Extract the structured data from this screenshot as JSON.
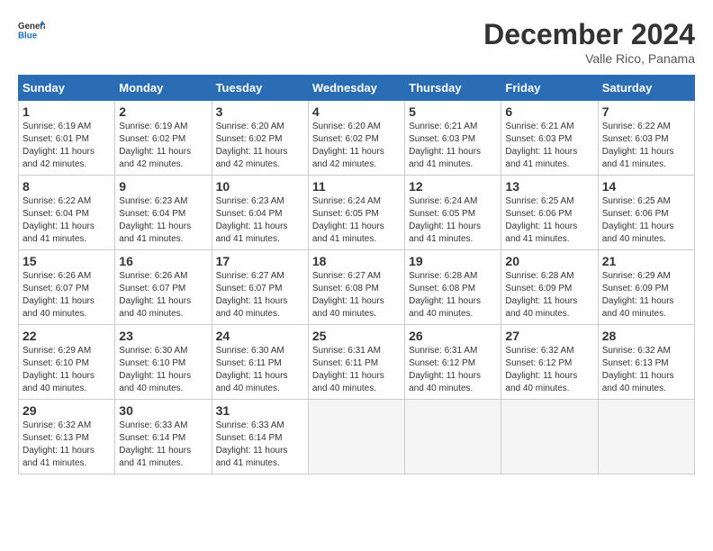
{
  "header": {
    "logo_general": "General",
    "logo_blue": "Blue",
    "month_title": "December 2024",
    "location": "Valle Rico, Panama"
  },
  "calendar": {
    "days_of_week": [
      "Sunday",
      "Monday",
      "Tuesday",
      "Wednesday",
      "Thursday",
      "Friday",
      "Saturday"
    ],
    "weeks": [
      [
        {
          "day": null,
          "info": null
        },
        {
          "day": null,
          "info": null
        },
        {
          "day": null,
          "info": null
        },
        {
          "day": null,
          "info": null
        },
        {
          "day": null,
          "info": null
        },
        {
          "day": null,
          "info": null
        },
        {
          "day": null,
          "info": null
        }
      ]
    ],
    "cells": [
      {
        "num": null,
        "sunrise": null,
        "sunset": null,
        "daylight": null
      },
      {
        "num": null,
        "sunrise": null,
        "sunset": null,
        "daylight": null
      },
      {
        "num": null,
        "sunrise": null,
        "sunset": null,
        "daylight": null
      },
      {
        "num": null,
        "sunrise": null,
        "sunset": null,
        "daylight": null
      },
      {
        "num": null,
        "sunrise": null,
        "sunset": null,
        "daylight": null
      },
      {
        "num": null,
        "sunrise": null,
        "sunset": null,
        "daylight": null
      },
      {
        "num": "1",
        "sunrise": "Sunrise: 6:19 AM",
        "sunset": "Sunset: 6:01 PM",
        "daylight": "Daylight: 11 hours and 42 minutes."
      },
      {
        "num": "2",
        "sunrise": "Sunrise: 6:19 AM",
        "sunset": "Sunset: 6:02 PM",
        "daylight": "Daylight: 11 hours and 42 minutes."
      },
      {
        "num": "3",
        "sunrise": "Sunrise: 6:20 AM",
        "sunset": "Sunset: 6:02 PM",
        "daylight": "Daylight: 11 hours and 42 minutes."
      },
      {
        "num": "4",
        "sunrise": "Sunrise: 6:20 AM",
        "sunset": "Sunset: 6:02 PM",
        "daylight": "Daylight: 11 hours and 42 minutes."
      },
      {
        "num": "5",
        "sunrise": "Sunrise: 6:21 AM",
        "sunset": "Sunset: 6:03 PM",
        "daylight": "Daylight: 11 hours and 41 minutes."
      },
      {
        "num": "6",
        "sunrise": "Sunrise: 6:21 AM",
        "sunset": "Sunset: 6:03 PM",
        "daylight": "Daylight: 11 hours and 41 minutes."
      },
      {
        "num": "7",
        "sunrise": "Sunrise: 6:22 AM",
        "sunset": "Sunset: 6:03 PM",
        "daylight": "Daylight: 11 hours and 41 minutes."
      },
      {
        "num": "8",
        "sunrise": "Sunrise: 6:22 AM",
        "sunset": "Sunset: 6:04 PM",
        "daylight": "Daylight: 11 hours and 41 minutes."
      },
      {
        "num": "9",
        "sunrise": "Sunrise: 6:23 AM",
        "sunset": "Sunset: 6:04 PM",
        "daylight": "Daylight: 11 hours and 41 minutes."
      },
      {
        "num": "10",
        "sunrise": "Sunrise: 6:23 AM",
        "sunset": "Sunset: 6:04 PM",
        "daylight": "Daylight: 11 hours and 41 minutes."
      },
      {
        "num": "11",
        "sunrise": "Sunrise: 6:24 AM",
        "sunset": "Sunset: 6:05 PM",
        "daylight": "Daylight: 11 hours and 41 minutes."
      },
      {
        "num": "12",
        "sunrise": "Sunrise: 6:24 AM",
        "sunset": "Sunset: 6:05 PM",
        "daylight": "Daylight: 11 hours and 41 minutes."
      },
      {
        "num": "13",
        "sunrise": "Sunrise: 6:25 AM",
        "sunset": "Sunset: 6:06 PM",
        "daylight": "Daylight: 11 hours and 41 minutes."
      },
      {
        "num": "14",
        "sunrise": "Sunrise: 6:25 AM",
        "sunset": "Sunset: 6:06 PM",
        "daylight": "Daylight: 11 hours and 40 minutes."
      },
      {
        "num": "15",
        "sunrise": "Sunrise: 6:26 AM",
        "sunset": "Sunset: 6:07 PM",
        "daylight": "Daylight: 11 hours and 40 minutes."
      },
      {
        "num": "16",
        "sunrise": "Sunrise: 6:26 AM",
        "sunset": "Sunset: 6:07 PM",
        "daylight": "Daylight: 11 hours and 40 minutes."
      },
      {
        "num": "17",
        "sunrise": "Sunrise: 6:27 AM",
        "sunset": "Sunset: 6:07 PM",
        "daylight": "Daylight: 11 hours and 40 minutes."
      },
      {
        "num": "18",
        "sunrise": "Sunrise: 6:27 AM",
        "sunset": "Sunset: 6:08 PM",
        "daylight": "Daylight: 11 hours and 40 minutes."
      },
      {
        "num": "19",
        "sunrise": "Sunrise: 6:28 AM",
        "sunset": "Sunset: 6:08 PM",
        "daylight": "Daylight: 11 hours and 40 minutes."
      },
      {
        "num": "20",
        "sunrise": "Sunrise: 6:28 AM",
        "sunset": "Sunset: 6:09 PM",
        "daylight": "Daylight: 11 hours and 40 minutes."
      },
      {
        "num": "21",
        "sunrise": "Sunrise: 6:29 AM",
        "sunset": "Sunset: 6:09 PM",
        "daylight": "Daylight: 11 hours and 40 minutes."
      },
      {
        "num": "22",
        "sunrise": "Sunrise: 6:29 AM",
        "sunset": "Sunset: 6:10 PM",
        "daylight": "Daylight: 11 hours and 40 minutes."
      },
      {
        "num": "23",
        "sunrise": "Sunrise: 6:30 AM",
        "sunset": "Sunset: 6:10 PM",
        "daylight": "Daylight: 11 hours and 40 minutes."
      },
      {
        "num": "24",
        "sunrise": "Sunrise: 6:30 AM",
        "sunset": "Sunset: 6:11 PM",
        "daylight": "Daylight: 11 hours and 40 minutes."
      },
      {
        "num": "25",
        "sunrise": "Sunrise: 6:31 AM",
        "sunset": "Sunset: 6:11 PM",
        "daylight": "Daylight: 11 hours and 40 minutes."
      },
      {
        "num": "26",
        "sunrise": "Sunrise: 6:31 AM",
        "sunset": "Sunset: 6:12 PM",
        "daylight": "Daylight: 11 hours and 40 minutes."
      },
      {
        "num": "27",
        "sunrise": "Sunrise: 6:32 AM",
        "sunset": "Sunset: 6:12 PM",
        "daylight": "Daylight: 11 hours and 40 minutes."
      },
      {
        "num": "28",
        "sunrise": "Sunrise: 6:32 AM",
        "sunset": "Sunset: 6:13 PM",
        "daylight": "Daylight: 11 hours and 40 minutes."
      },
      {
        "num": "29",
        "sunrise": "Sunrise: 6:32 AM",
        "sunset": "Sunset: 6:13 PM",
        "daylight": "Daylight: 11 hours and 41 minutes."
      },
      {
        "num": "30",
        "sunrise": "Sunrise: 6:33 AM",
        "sunset": "Sunset: 6:14 PM",
        "daylight": "Daylight: 11 hours and 41 minutes."
      },
      {
        "num": "31",
        "sunrise": "Sunrise: 6:33 AM",
        "sunset": "Sunset: 6:14 PM",
        "daylight": "Daylight: 11 hours and 41 minutes."
      },
      {
        "num": null,
        "sunrise": null,
        "sunset": null,
        "daylight": null
      },
      {
        "num": null,
        "sunrise": null,
        "sunset": null,
        "daylight": null
      },
      {
        "num": null,
        "sunrise": null,
        "sunset": null,
        "daylight": null
      },
      {
        "num": null,
        "sunrise": null,
        "sunset": null,
        "daylight": null
      },
      {
        "num": null,
        "sunrise": null,
        "sunset": null,
        "daylight": null
      }
    ]
  }
}
